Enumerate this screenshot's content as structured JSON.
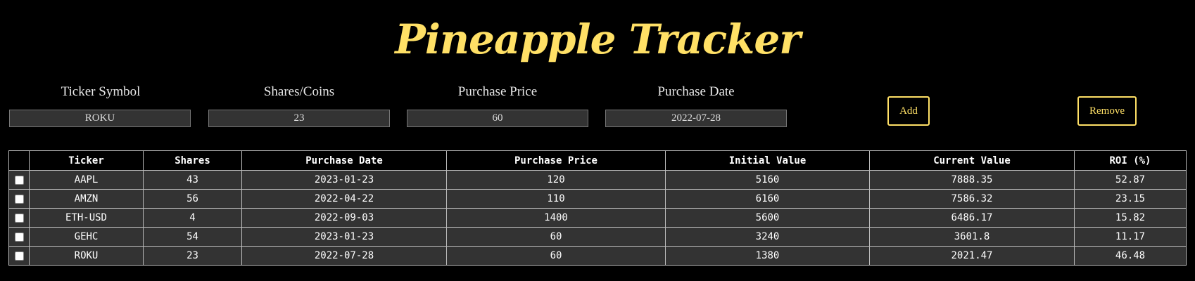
{
  "app": {
    "title": "Pineapple Tracker"
  },
  "form": {
    "fields": [
      {
        "label": "Ticker Symbol",
        "value": "ROKU"
      },
      {
        "label": "Shares/Coins",
        "value": "23"
      },
      {
        "label": "Purchase Price",
        "value": "60"
      },
      {
        "label": "Purchase Date",
        "value": "2022-07-28"
      }
    ],
    "add_label": "Add",
    "remove_label": "Remove"
  },
  "table": {
    "headers": [
      "",
      "Ticker",
      "Shares",
      "Purchase Date",
      "Purchase Price",
      "Initial Value",
      "Current Value",
      "ROI (%)"
    ],
    "rows": [
      {
        "checked": false,
        "ticker": "AAPL",
        "shares": "43",
        "purchase_date": "2023-01-23",
        "purchase_price": "120",
        "initial_value": "5160",
        "current_value": "7888.35",
        "roi": "52.87"
      },
      {
        "checked": false,
        "ticker": "AMZN",
        "shares": "56",
        "purchase_date": "2022-04-22",
        "purchase_price": "110",
        "initial_value": "6160",
        "current_value": "7586.32",
        "roi": "23.15"
      },
      {
        "checked": false,
        "ticker": "ETH-USD",
        "shares": "4",
        "purchase_date": "2022-09-03",
        "purchase_price": "1400",
        "initial_value": "5600",
        "current_value": "6486.17",
        "roi": "15.82"
      },
      {
        "checked": false,
        "ticker": "GEHC",
        "shares": "54",
        "purchase_date": "2023-01-23",
        "purchase_price": "60",
        "initial_value": "3240",
        "current_value": "3601.8",
        "roi": "11.17"
      },
      {
        "checked": false,
        "ticker": "ROKU",
        "shares": "23",
        "purchase_date": "2022-07-28",
        "purchase_price": "60",
        "initial_value": "1380",
        "current_value": "2021.47",
        "roi": "46.48"
      }
    ]
  },
  "colors": {
    "accent": "#ffe066",
    "background": "#000000",
    "cell_background": "#333333"
  }
}
